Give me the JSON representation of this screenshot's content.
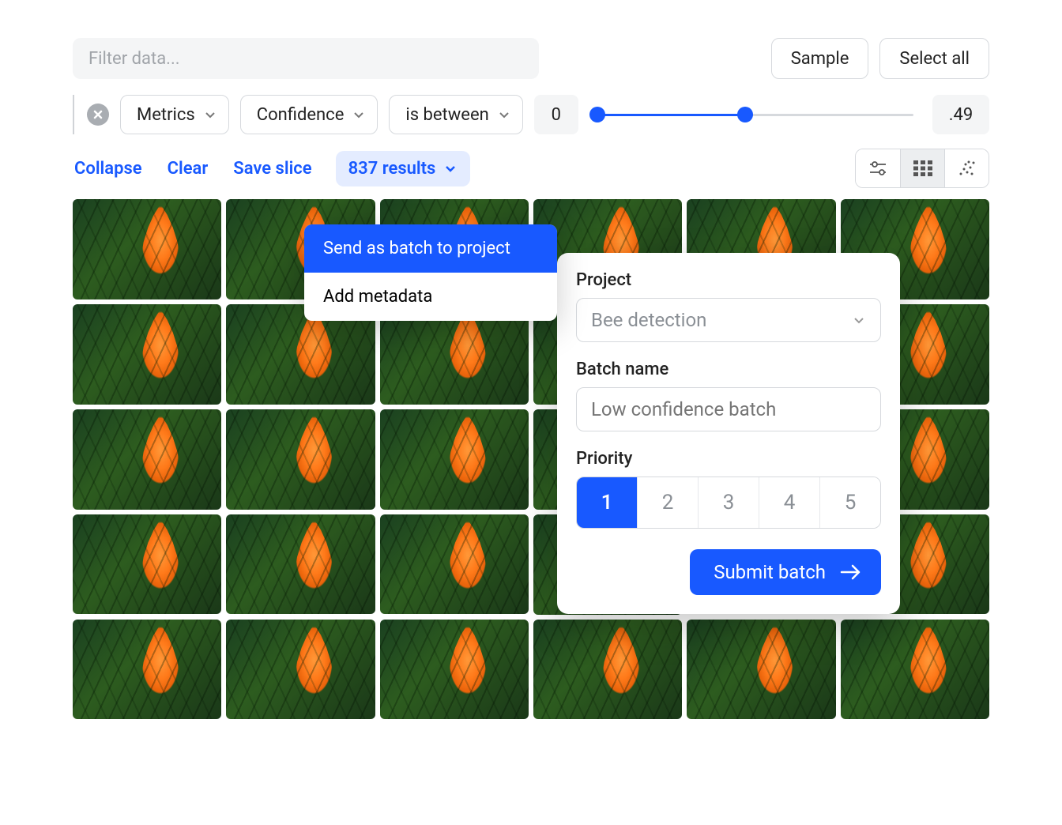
{
  "filter": {
    "placeholder": "Filter data..."
  },
  "buttons": {
    "sample": "Sample",
    "select_all": "Select all"
  },
  "filter_chips": {
    "metrics": "Metrics",
    "confidence": "Confidence",
    "operator": "is between",
    "min": "0",
    "max": ".49"
  },
  "actions": {
    "collapse": "Collapse",
    "clear": "Clear",
    "save_slice": "Save slice",
    "results": "837 results"
  },
  "context_menu": {
    "send_batch": "Send as batch to project",
    "add_metadata": "Add metadata"
  },
  "panel": {
    "project_label": "Project",
    "project_value": "Bee detection",
    "batch_label": "Batch name",
    "batch_placeholder": "Low confidence batch",
    "priority_label": "Priority",
    "priorities": [
      "1",
      "2",
      "3",
      "4",
      "5"
    ],
    "submit": "Submit batch"
  }
}
